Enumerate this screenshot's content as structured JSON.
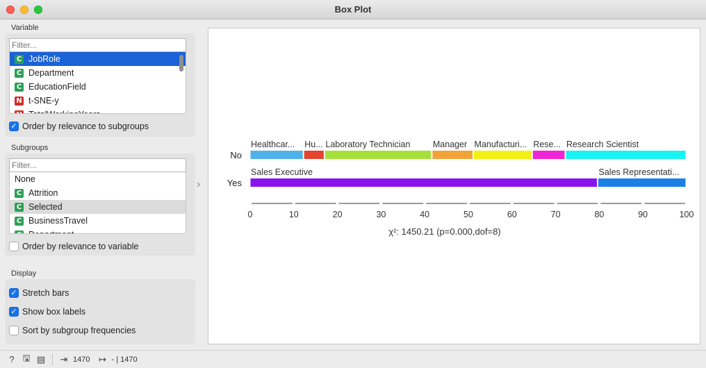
{
  "window": {
    "title": "Box Plot"
  },
  "variable": {
    "label": "Variable",
    "filter_placeholder": "Filter...",
    "items": [
      {
        "type": "C",
        "label": "JobRole",
        "selected": true
      },
      {
        "type": "C",
        "label": "Department"
      },
      {
        "type": "C",
        "label": "EducationField"
      },
      {
        "type": "N",
        "label": "t-SNE-y"
      },
      {
        "type": "N",
        "label": "TotalWorkingYears"
      }
    ],
    "order_checkbox": {
      "label": "Order by relevance to subgroups",
      "checked": true
    }
  },
  "subgroups": {
    "label": "Subgroups",
    "filter_placeholder": "Filter...",
    "items": [
      {
        "type": "",
        "label": "None"
      },
      {
        "type": "C",
        "label": "Attrition"
      },
      {
        "type": "C",
        "label": "Selected",
        "highlighted": true
      },
      {
        "type": "C",
        "label": "BusinessTravel"
      },
      {
        "type": "C",
        "label": "Department"
      }
    ],
    "order_checkbox": {
      "label": "Order by relevance to variable",
      "checked": false
    }
  },
  "display": {
    "label": "Display",
    "options": [
      {
        "label": "Stretch bars",
        "checked": true
      },
      {
        "label": "Show box labels",
        "checked": true
      },
      {
        "label": "Sort by subgroup frequencies",
        "checked": false
      }
    ]
  },
  "chart_data": {
    "type": "bar",
    "orientation": "horizontal",
    "stacked": true,
    "stretched": true,
    "rows": [
      {
        "label": "No",
        "segments": [
          {
            "label": "Healthcar...",
            "value": 12.3,
            "color": "#4fb3ea"
          },
          {
            "label": "Hu...",
            "value": 4.8,
            "color": "#e5452e"
          },
          {
            "label": "Laboratory Technician",
            "value": 24.6,
            "color": "#a6e03b"
          },
          {
            "label": "Manager",
            "value": 9.5,
            "color": "#f2a338"
          },
          {
            "label": "Manufacturi...",
            "value": 13.5,
            "color": "#f3f015"
          },
          {
            "label": "Rese...",
            "value": 7.6,
            "color": "#f025d5"
          },
          {
            "label": "Research Scientist",
            "value": 27.7,
            "color": "#19f2f2"
          }
        ]
      },
      {
        "label": "Yes",
        "segments": [
          {
            "label": "Sales Executive",
            "value": 79.7,
            "color": "#8a14ee"
          },
          {
            "label": "Sales Representati...",
            "value": 20.3,
            "color": "#1a7fe6"
          }
        ]
      }
    ],
    "x_ticks": [
      0,
      10,
      20,
      30,
      40,
      50,
      60,
      70,
      80,
      90,
      100
    ],
    "xlim": [
      0,
      100
    ],
    "statistic": "χ²: 1450.21 (p=0.000,dof=8)"
  },
  "status": {
    "input_count": "1470",
    "output_text": "- | 1470"
  }
}
